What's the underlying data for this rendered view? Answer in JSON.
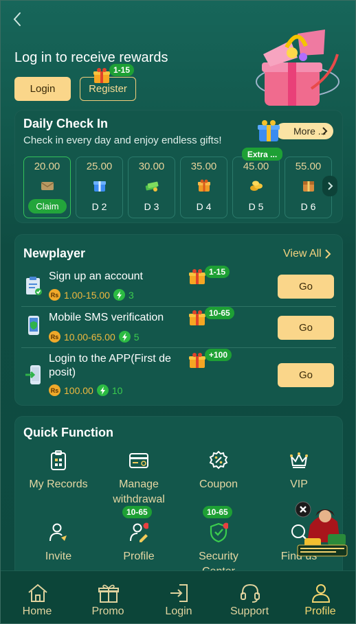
{
  "header": {
    "title": "Log in to receive rewards",
    "login_label": "Login",
    "register_label": "Register",
    "register_badge": "1-15"
  },
  "checkin": {
    "title": "Daily Check In",
    "subtitle": "Check in every day and enjoy endless gifts!",
    "more_label": "More ...",
    "extra_badge": "Extra ...",
    "days": [
      {
        "amount": "20.00",
        "label": "Claim"
      },
      {
        "amount": "25.00",
        "label": "D 2"
      },
      {
        "amount": "30.00",
        "label": "D 3"
      },
      {
        "amount": "35.00",
        "label": "D 4"
      },
      {
        "amount": "45.00",
        "label": "D 5"
      },
      {
        "amount": "55.00",
        "label": "D 6"
      }
    ]
  },
  "newplayer": {
    "title": "Newplayer",
    "view_all": "View All",
    "currency_badge": "Rs",
    "tasks": [
      {
        "title": "Sign up an account",
        "badge": "1-15",
        "reward": "1.00-15.00",
        "energy": "3",
        "button": "Go"
      },
      {
        "title": "Mobile SMS verification",
        "badge": "10-65",
        "reward": "10.00-65.00",
        "energy": "5",
        "button": "Go"
      },
      {
        "title": "Login to the APP(First de posit)",
        "badge": "+100",
        "reward": "100.00",
        "energy": "10",
        "button": "Go"
      }
    ]
  },
  "quick": {
    "title": "Quick Function",
    "items": [
      {
        "label": "My Records"
      },
      {
        "label": "Manage withdrawal"
      },
      {
        "label": "Coupon"
      },
      {
        "label": "VIP"
      },
      {
        "label": "Invite"
      },
      {
        "label": "Profile",
        "badge": "10-65"
      },
      {
        "label": "Security Center",
        "badge": "10-65"
      },
      {
        "label": "Find us"
      }
    ]
  },
  "nav": {
    "items": [
      {
        "label": "Home"
      },
      {
        "label": "Promo"
      },
      {
        "label": "Login"
      },
      {
        "label": "Support"
      },
      {
        "label": "Profile"
      }
    ]
  },
  "colors": {
    "background": "#0f4a3f",
    "card": "#13574b",
    "accent_gold": "#fad68a",
    "badge_green": "#1ea035",
    "label_gold": "#e5d7a3"
  }
}
